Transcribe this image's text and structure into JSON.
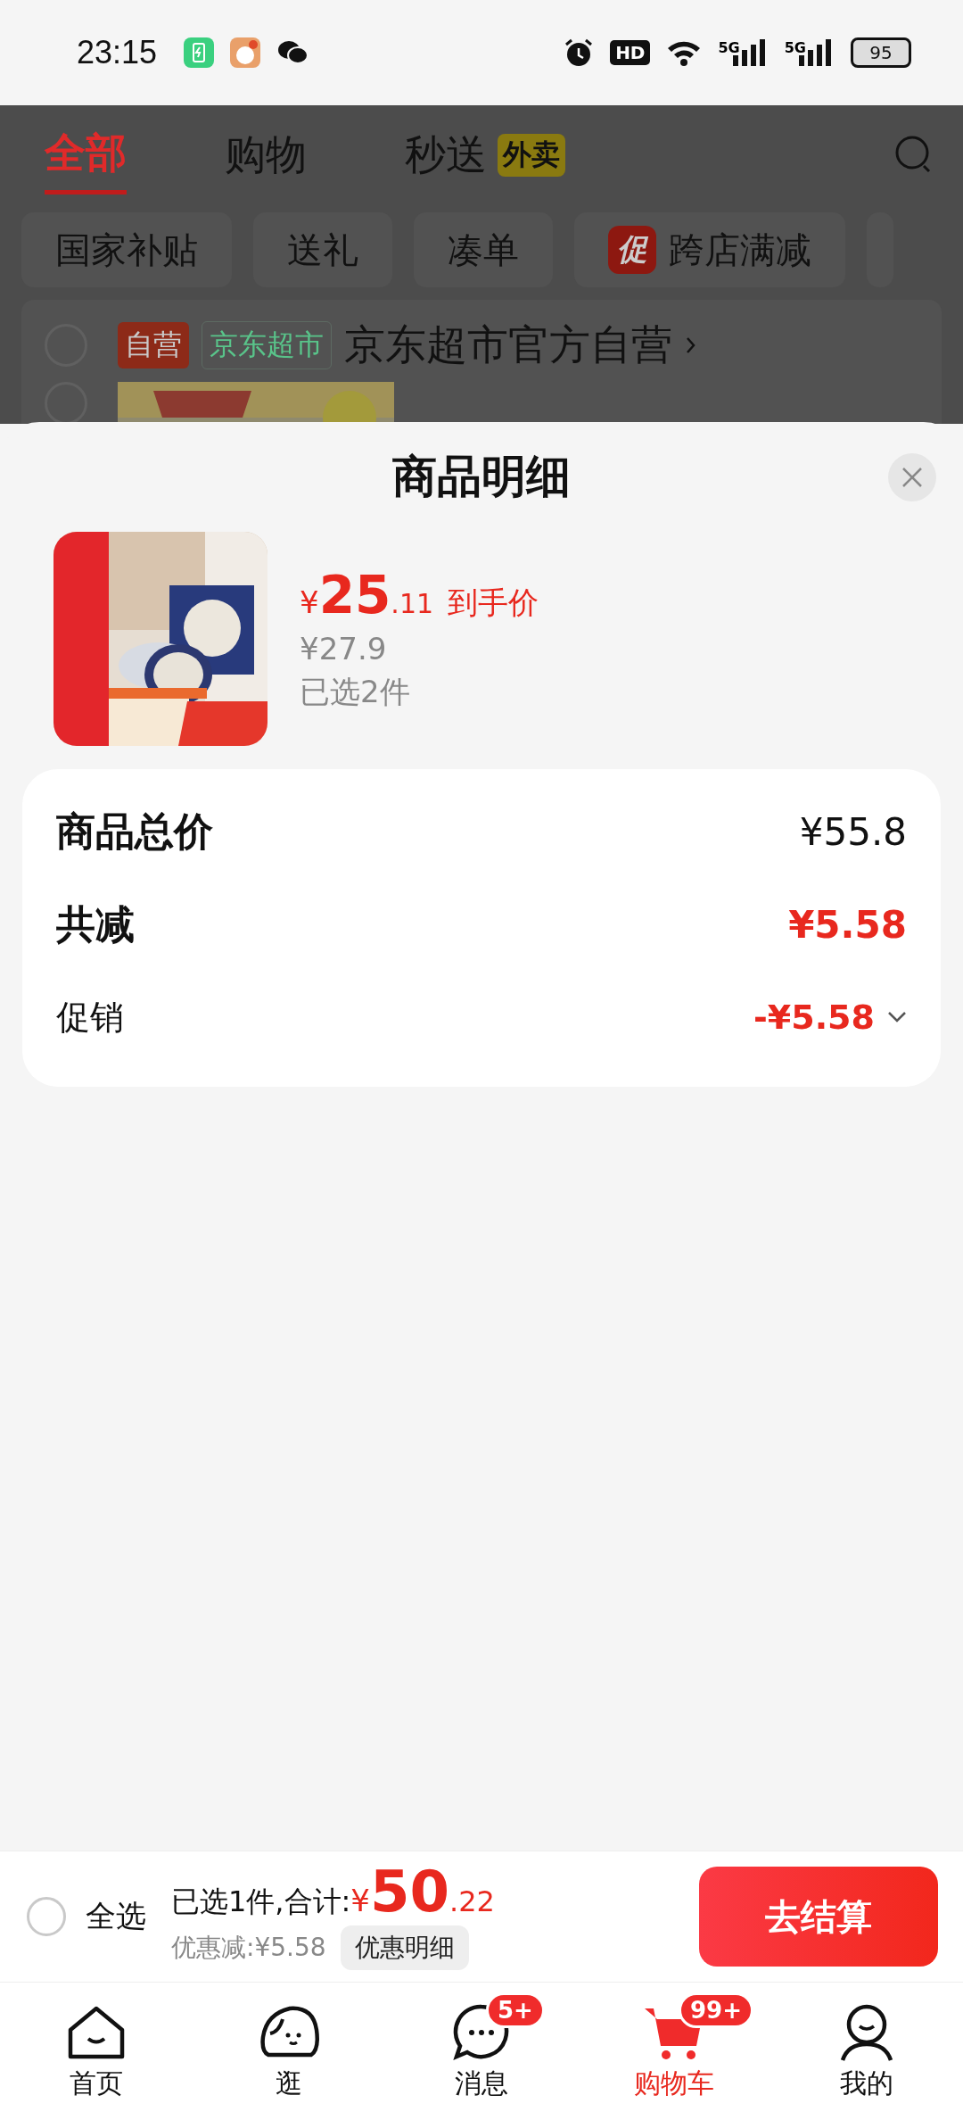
{
  "status_bar": {
    "time": "23:15",
    "hd": "HD",
    "networks": [
      "5G",
      "5G"
    ],
    "battery": "95"
  },
  "background": {
    "tabs": [
      {
        "label": "全部",
        "selected": true
      },
      {
        "label": "购物",
        "selected": false
      },
      {
        "label": "秒送",
        "selected": false,
        "badge": "外卖"
      }
    ],
    "chips": [
      {
        "label": "国家补贴"
      },
      {
        "label": "送礼"
      },
      {
        "label": "凑单"
      },
      {
        "label": "跨店满减",
        "tag": "促"
      }
    ],
    "store": {
      "checked": false,
      "tags": [
        {
          "text": "自营",
          "kind": "solid"
        },
        {
          "text": "京东超市",
          "kind": "outline"
        }
      ],
      "name": "京东超市官方自营"
    },
    "item": {
      "checked": false
    }
  },
  "sheet": {
    "title": "商品明细",
    "product": {
      "currency": "¥",
      "price_int": "25",
      "price_dec": ".11",
      "price_label": "到手价",
      "original_price": "¥27.9",
      "quantity": "已选2件"
    },
    "summary": [
      {
        "label": "商品总价",
        "value": "¥55.8",
        "kind": "total"
      },
      {
        "label": "共减",
        "value": "¥5.58",
        "kind": "discount"
      },
      {
        "label": "促销",
        "value": "-¥5.58",
        "kind": "promo",
        "expanded": false
      }
    ]
  },
  "checkout": {
    "select_all": {
      "label": "全选",
      "checked": false
    },
    "selected_text": "已选1件,合计:",
    "currency": "¥",
    "total_int": "50",
    "total_dec": ".22",
    "saving": "优惠减:¥5.58",
    "detail_button": "优惠明细",
    "submit": "去结算"
  },
  "nav": [
    {
      "label": "首页",
      "kind": "home",
      "selected": false
    },
    {
      "label": "逛",
      "kind": "browse",
      "selected": false
    },
    {
      "label": "消息",
      "kind": "message",
      "selected": false,
      "badge": "5+"
    },
    {
      "label": "购物车",
      "kind": "cart",
      "selected": true,
      "badge": "99+"
    },
    {
      "label": "我的",
      "kind": "person",
      "selected": false
    }
  ]
}
